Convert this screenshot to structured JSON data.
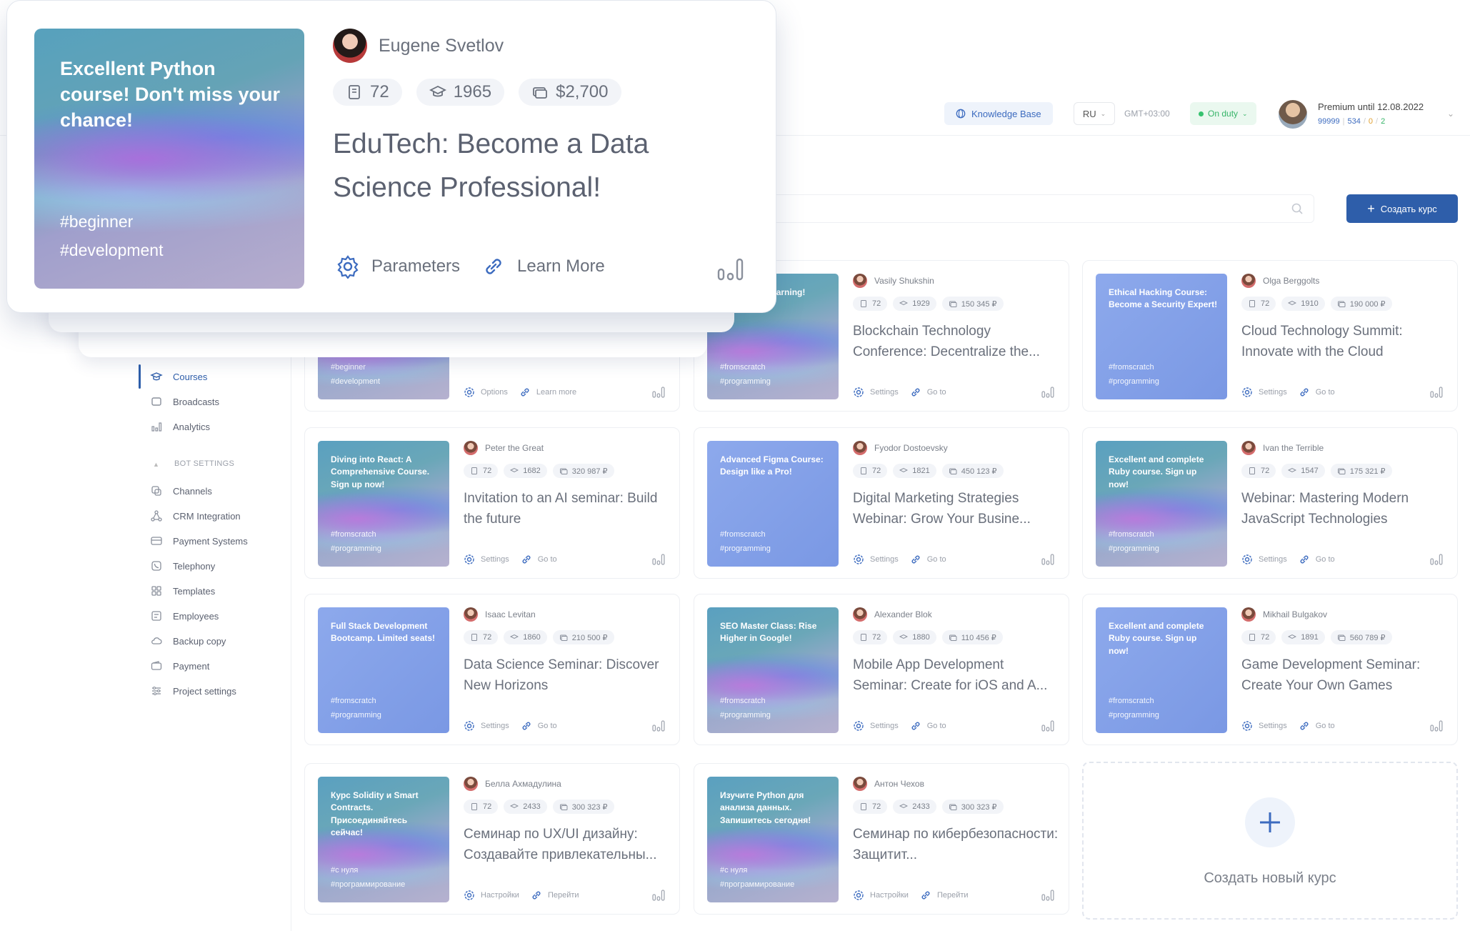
{
  "header": {
    "knowledge_base": "Knowledge Base",
    "lang": "RU",
    "gmt": "GMT+03:00",
    "duty": "On duty",
    "premium": "Premium until 12.08.2022",
    "counts": {
      "a": "99999",
      "b": "534",
      "c": "0",
      "d": "2"
    },
    "create_button": "Создать курс",
    "colors": {
      "accent": "#2e5eaa",
      "duty_green": "#36b468"
    }
  },
  "sidebar": {
    "items": [
      "Courses",
      "Broadcasts",
      "Analytics"
    ],
    "section_heading": "BOT SETTINGS",
    "settings": [
      "Channels",
      "CRM Integration",
      "Payment Systems",
      "Telephony",
      "Templates",
      "Employees",
      "Backup copy",
      "Payment",
      "Project settings"
    ]
  },
  "popup": {
    "thumb_title": "Excellent Python course! Don't miss your chance!",
    "tags": [
      "#beginner",
      "#development"
    ],
    "author": "Eugene Svetlov",
    "stats": [
      "72",
      "1965",
      "$2,700"
    ],
    "title": "EduTech: Become a Data Science Professional!",
    "actions": [
      "Parameters",
      "Learn More"
    ]
  },
  "cards": [
    {
      "thumb": "",
      "tags": [
        "#beginner",
        "#development"
      ],
      "author": "",
      "stats": [
        "",
        "",
        ""
      ],
      "title": "",
      "actions": [
        "Options",
        "Learn more"
      ]
    },
    {
      "thumb": "ed ourse. rt learning!",
      "tags": [
        "#fromscratch",
        "#programming"
      ],
      "author": "Vasily Shukshin",
      "stats": [
        "72",
        "1929",
        "150 345 ₽"
      ],
      "title": "Blockchain Technology Conference: Decentralize the...",
      "actions": [
        "Settings",
        "Go to"
      ]
    },
    {
      "thumb": "Ethical Hacking Course: Become a Security Expert!",
      "tags": [
        "#fromscratch",
        "#programming"
      ],
      "author": "Olga Berggolts",
      "stats": [
        "72",
        "1910",
        "190 000 ₽"
      ],
      "title": "Cloud Technology Summit: Innovate with the Cloud",
      "actions": [
        "Settings",
        "Go to"
      ]
    },
    {
      "thumb": "Diving into React: A Comprehensive Course. Sign up now!",
      "tags": [
        "#fromscratch",
        "#programming"
      ],
      "author": "Peter the Great",
      "stats": [
        "72",
        "1682",
        "320 987 ₽"
      ],
      "title": "Invitation to an AI seminar: Build the future",
      "actions": [
        "Settings",
        "Go to"
      ]
    },
    {
      "thumb": "Advanced Figma Course: Design like a Pro!",
      "tags": [
        "#fromscratch",
        "#programming"
      ],
      "author": "Fyodor Dostoevsky",
      "stats": [
        "72",
        "1821",
        "450 123 ₽"
      ],
      "title": "Digital Marketing Strategies Webinar: Grow Your Busine...",
      "actions": [
        "Settings",
        "Go to"
      ]
    },
    {
      "thumb": "Excellent and complete Ruby course. Sign up now!",
      "tags": [
        "#fromscratch",
        "#programming"
      ],
      "author": "Ivan the Terrible",
      "stats": [
        "72",
        "1547",
        "175 321 ₽"
      ],
      "title": "Webinar: Mastering Modern JavaScript Technologies",
      "actions": [
        "Settings",
        "Go to"
      ]
    },
    {
      "thumb": "Full Stack Development Bootcamp. Limited seats!",
      "tags": [
        "#fromscratch",
        "#programming"
      ],
      "author": "Isaac Levitan",
      "stats": [
        "72",
        "1860",
        "210 500 ₽"
      ],
      "title": "Data Science Seminar: Discover New Horizons",
      "actions": [
        "Settings",
        "Go to"
      ]
    },
    {
      "thumb": "SEO Master Class: Rise Higher in Google!",
      "tags": [
        "#fromscratch",
        "#programming"
      ],
      "author": "Alexander Blok",
      "stats": [
        "72",
        "1880",
        "110 456 ₽"
      ],
      "title": "Mobile App Development Seminar: Create for iOS and A...",
      "actions": [
        "Settings",
        "Go to"
      ]
    },
    {
      "thumb": "Excellent and complete Ruby course. Sign up now!",
      "tags": [
        "#fromscratch",
        "#programming"
      ],
      "author": "Mikhail Bulgakov",
      "stats": [
        "72",
        "1891",
        "560 789 ₽"
      ],
      "title": "Game Development Seminar: Create Your Own Games",
      "actions": [
        "Settings",
        "Go to"
      ]
    },
    {
      "thumb": "Курс Solidity и Smart Contracts. Присоединяйтесь сейчас!",
      "tags": [
        "#с нуля",
        "#программирование"
      ],
      "author": "Белла Ахмадулина",
      "stats": [
        "72",
        "2433",
        "300 323 ₽"
      ],
      "title": "Семинар по UX/UI дизайну: Создавайте привлекательны...",
      "actions": [
        "Настройки",
        "Перейти"
      ]
    },
    {
      "thumb": "Изучите Python для анализа данных. Запишитесь сегодня!",
      "tags": [
        "#с нуля",
        "#программирование"
      ],
      "author": "Антон Чехов",
      "stats": [
        "72",
        "2433",
        "300 323 ₽"
      ],
      "title": "Семинар по кибербезопасности: Защитит...",
      "actions": [
        "Настройки",
        "Перейти"
      ]
    }
  ],
  "new_course": "Создать новый курс"
}
